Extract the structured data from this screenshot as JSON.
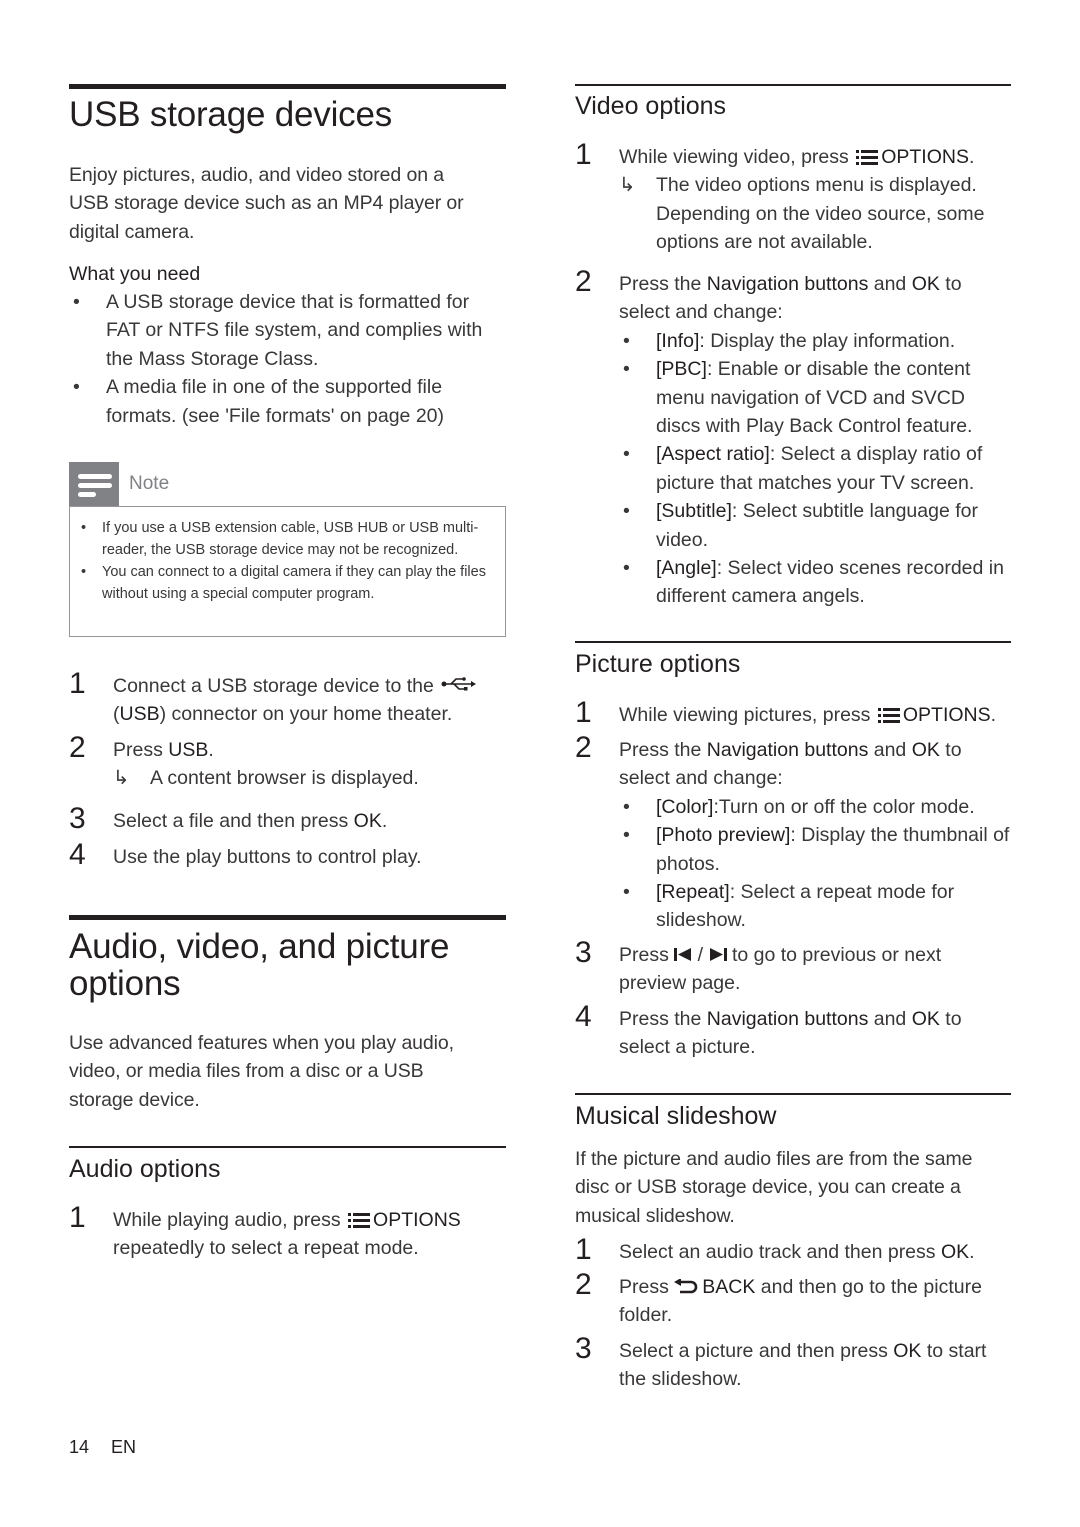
{
  "usb_section": {
    "title": "USB storage devices",
    "intro": "Enjoy pictures, audio, and video stored on a USB storage device such as an MP4 player or digital camera.",
    "what_you_need_label": "What you need",
    "needs": [
      "A USB storage device that is formatted for FAT or NTFS file system, and complies with the Mass Storage Class.",
      "A media file in one of the supported file formats. (see 'File formats' on page 20)"
    ],
    "note": {
      "label": "Note",
      "items": [
        "If you use a USB extension cable, USB HUB or USB multi-reader, the USB storage device may not be recognized.",
        "You can connect to a digital camera if they can play the files without using a special computer program."
      ]
    },
    "steps": [
      {
        "num": "1",
        "pre": "Connect a USB storage device to the",
        "icon": "usb-icon",
        "mid_open": "(",
        "bold": "USB",
        "post": ") connector on your home theater."
      },
      {
        "num": "2",
        "pre": "Press ",
        "bold": "USB",
        "post": ".",
        "result": "A content browser is displayed."
      },
      {
        "num": "3",
        "pre": "Select a file and then press ",
        "bold": "OK",
        "post": "."
      },
      {
        "num": "4",
        "pre": "Use the play buttons to control play."
      }
    ]
  },
  "avp_section": {
    "title_line1": "Audio, video, and picture",
    "title_line2": "options",
    "intro": "Use advanced features when you play audio, video, or media files from a disc or a USB storage device."
  },
  "audio_options": {
    "title": "Audio options",
    "steps": [
      {
        "num": "1",
        "pre": "While playing audio, press",
        "icon": "options-icon",
        "bold": "OPTIONS",
        "post": "repeatedly to select a repeat mode."
      }
    ]
  },
  "video_options": {
    "title": "Video options",
    "step1": {
      "num": "1",
      "pre": "While viewing video, press",
      "icon": "options-icon",
      "bold": "OPTIONS",
      "post": ".",
      "result": "The video options menu is displayed. Depending on the video source, some options are not available."
    },
    "step2": {
      "num": "2",
      "pre": "Press the ",
      "bold": "Navigation buttons",
      "mid": " and ",
      "bold2": "OK",
      "post": " to select and change:"
    },
    "items": [
      {
        "key": "[Info]",
        "desc": ": Display the play information."
      },
      {
        "key": "[PBC]",
        "desc": ": Enable or disable the content menu navigation of VCD and SVCD discs with Play Back Control feature."
      },
      {
        "key": "[Aspect ratio]",
        "desc": ": Select a display ratio of picture that matches your TV screen."
      },
      {
        "key": "[Subtitle]",
        "desc": ": Select subtitle language for video."
      },
      {
        "key": "[Angle]",
        "desc": ": Select video scenes recorded in different camera angels."
      }
    ]
  },
  "picture_options": {
    "title": "Picture options",
    "step1": {
      "num": "1",
      "pre": "While viewing pictures, press",
      "icon": "options-icon",
      "bold": "OPTIONS",
      "post": "."
    },
    "step2": {
      "num": "2",
      "pre": "Press the ",
      "bold": "Navigation buttons",
      "mid": " and ",
      "bold2": "OK",
      "post": " to select and change:"
    },
    "items": [
      {
        "key": "[Color]",
        "desc": ":Turn on or off the color mode."
      },
      {
        "key": "[Photo preview]",
        "desc": ": Display the thumbnail of photos."
      },
      {
        "key": "[Repeat]",
        "desc": ": Select a repeat mode for slideshow."
      }
    ],
    "step3": {
      "num": "3",
      "pre": "Press ",
      "icons": [
        "previous-icon",
        "next-icon"
      ],
      "sep": " / ",
      "post": " to go to previous or next preview page."
    },
    "step4": {
      "num": "4",
      "pre": "Press the ",
      "bold": "Navigation buttons",
      "mid": " and ",
      "bold2": "OK",
      "post": " to select a picture."
    }
  },
  "musical_slideshow": {
    "title": "Musical slideshow",
    "intro": "If the picture and audio files are from the same disc or USB storage device, you can create a musical slideshow.",
    "step1": {
      "num": "1",
      "pre": "Select an audio track and then press ",
      "bold": "OK",
      "post": "."
    },
    "step2": {
      "num": "2",
      "pre": "Press ",
      "icon": "back-icon",
      "bold": "BACK",
      "post": " and then go to the picture folder."
    },
    "step3": {
      "num": "3",
      "pre": "Select a picture and then press ",
      "bold": "OK",
      "post": " to start the slideshow."
    }
  },
  "footer": {
    "page_number": "14",
    "language": "EN"
  },
  "icons": {
    "arrow": "↳",
    "bullet": "•"
  }
}
